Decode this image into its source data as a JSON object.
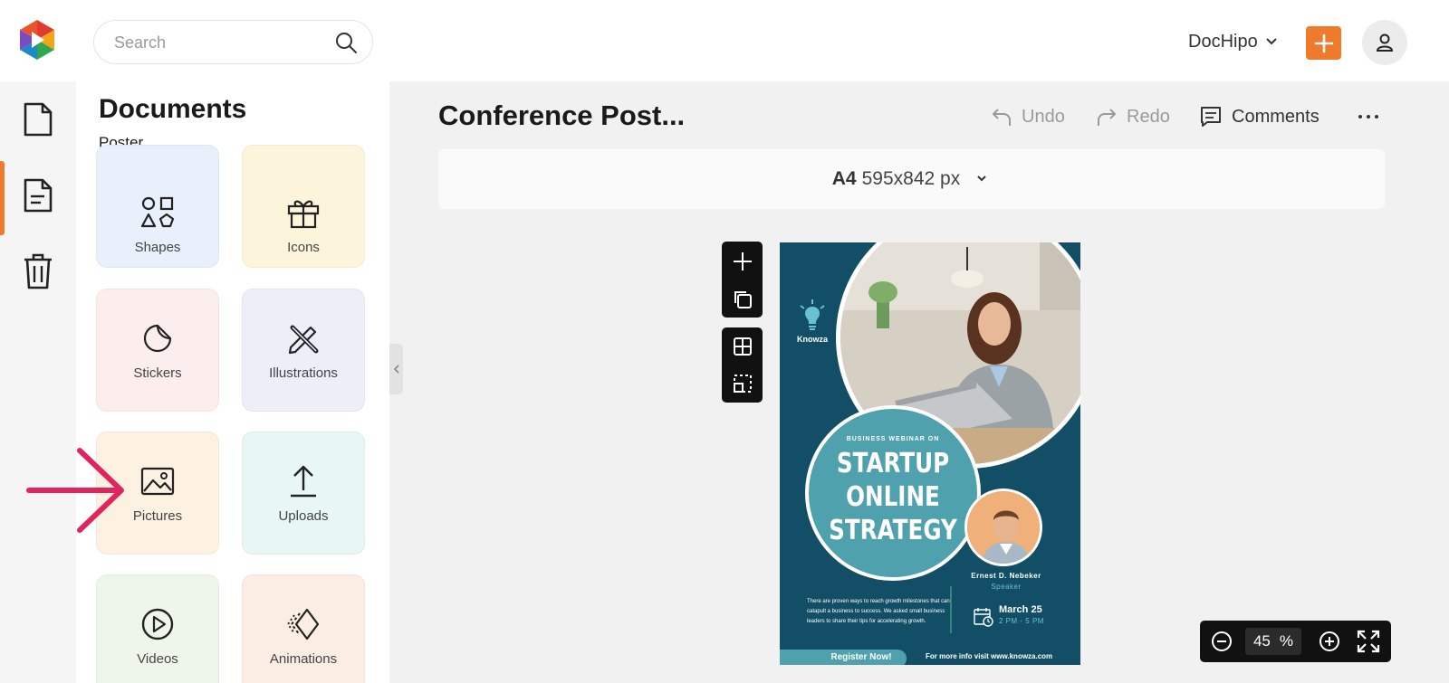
{
  "header": {
    "search_placeholder": "Search",
    "brand_menu_label": "DocHipo",
    "accent_color": "#f07a2b"
  },
  "rail": {
    "items": [
      {
        "icon": "document-icon"
      },
      {
        "icon": "document-lines-icon",
        "active": true
      },
      {
        "icon": "trash-icon"
      }
    ]
  },
  "panel": {
    "title": "Documents",
    "subtitle": "Poster",
    "tiles": [
      {
        "label": "Shapes",
        "icon": "shapes-icon",
        "color": "#e8f0fb"
      },
      {
        "label": "Icons",
        "icon": "gift-icon",
        "color": "#fdf4dc"
      },
      {
        "label": "Stickers",
        "icon": "sticker-icon",
        "color": "#fdeeee"
      },
      {
        "label": "Illustrations",
        "icon": "pen-ruler-icon",
        "color": "#eeeef9"
      },
      {
        "label": "Pictures",
        "icon": "picture-icon",
        "color": "#fdf1e2"
      },
      {
        "label": "Uploads",
        "icon": "upload-icon",
        "color": "#e8f6f6"
      },
      {
        "label": "Videos",
        "icon": "play-circle-icon",
        "color": "#eef6ec"
      },
      {
        "label": "Animations",
        "icon": "animation-icon",
        "color": "#fcede4"
      }
    ]
  },
  "editor": {
    "document_title": "Conference Post...",
    "undo_label": "Undo",
    "redo_label": "Redo",
    "comments_label": "Comments",
    "page_size_name": "A4",
    "page_size_dims": "595x842 px",
    "zoom_value": "45",
    "zoom_unit": "%"
  },
  "poster": {
    "brand": "Knowza",
    "kicker": "BUSINESS WEBINAR ON",
    "headline": [
      "STARTUP",
      "ONLINE",
      "STRATEGY"
    ],
    "speaker_name": "Ernest D. Nebeker",
    "speaker_role": "Speaker",
    "body": "There are proven ways to reach growth milestones that can catapult a business to success. We asked small business leaders to share their tips for accelerating growth.",
    "date": "March 25",
    "time": "2 PM - 5 PM",
    "cta": "Register Now!",
    "more_info": "For more info visit www.knowza.com",
    "colors": {
      "background": "#124f66",
      "accent": "#4fa1ad",
      "highlight": "#69c1cf"
    }
  }
}
